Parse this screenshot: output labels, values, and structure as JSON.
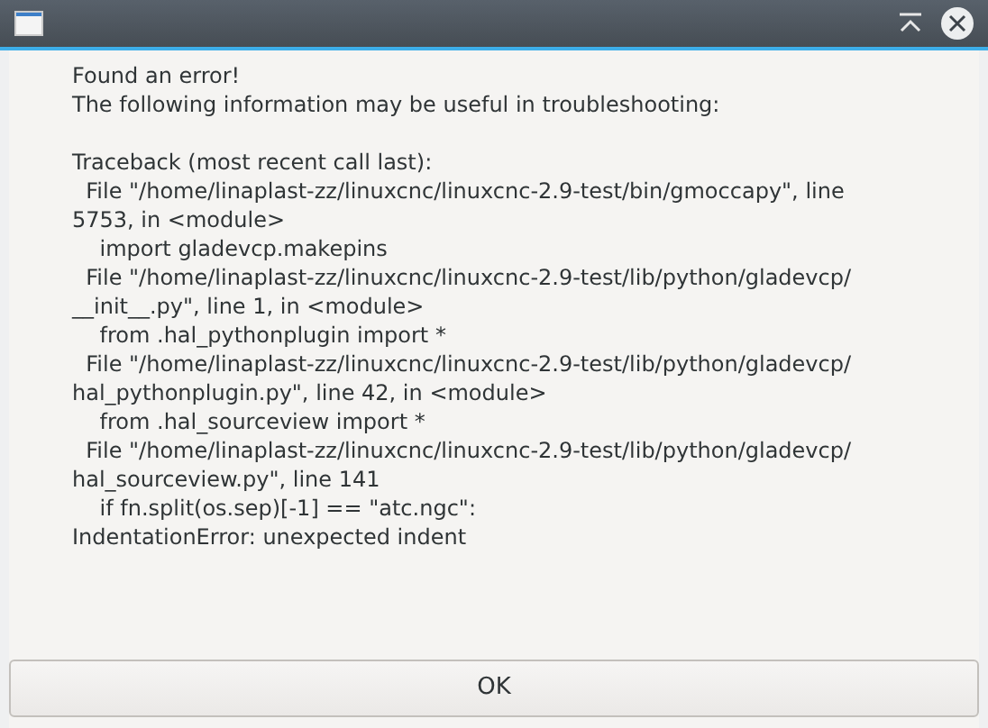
{
  "window": {
    "title_bar": {
      "buttons": [
        {
          "kind": "minimize"
        },
        {
          "kind": "close"
        }
      ]
    }
  },
  "message": [
    "Found an error!",
    "The following information may be useful in troubleshooting:"
  ],
  "traceback": [
    "Traceback (most recent call last):",
    "  File \"/home/linaplast-zz/linuxcnc/linuxcnc-2.9-test/bin/gmoccapy\", line",
    "5753, in <module>",
    "    import gladevcp.makepins",
    "  File \"/home/linaplast-zz/linuxcnc/linuxcnc-2.9-test/lib/python/gladevcp/",
    "__init__.py\", line 1, in <module>",
    "    from .hal_pythonplugin import *",
    "  File \"/home/linaplast-zz/linuxcnc/linuxcnc-2.9-test/lib/python/gladevcp/",
    "hal_pythonplugin.py\", line 42, in <module>",
    "    from .hal_sourceview import *",
    "  File \"/home/linaplast-zz/linuxcnc/linuxcnc-2.9-test/lib/python/gladevcp/",
    "hal_sourceview.py\", line 141",
    "    if fn.split(os.sep)[-1] == \"atc.ngc\":",
    "IndentationError: unexpected indent"
  ],
  "buttons": [
    "OK"
  ]
}
